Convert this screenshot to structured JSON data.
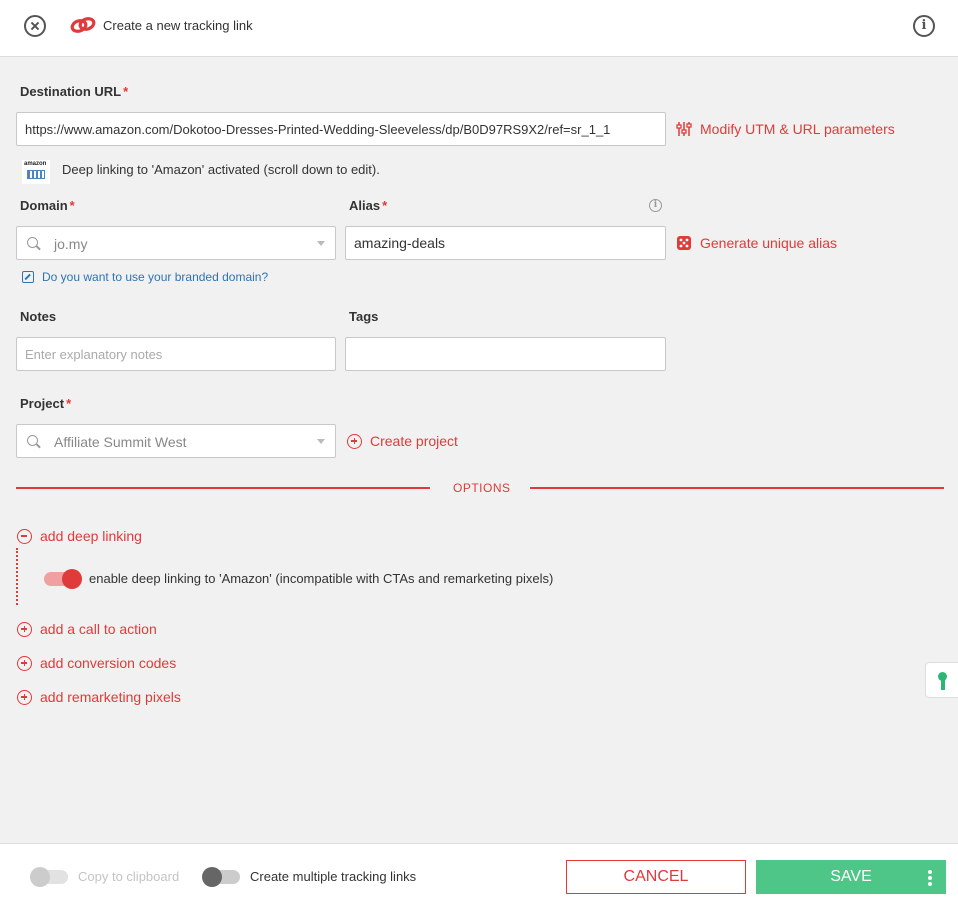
{
  "header": {
    "title": "Create a new tracking link"
  },
  "destination": {
    "label": "Destination URL",
    "value": "https://www.amazon.com/Dokotoo-Dresses-Printed-Wedding-Sleeveless/dp/B0D97RS9X2/ref=sr_1_1",
    "utm_link": "Modify UTM & URL parameters",
    "amazon_logo_text": "amazon",
    "deep_link_note": "Deep linking to 'Amazon' activated (scroll down to edit)."
  },
  "domain": {
    "label": "Domain",
    "value": "jo.my",
    "branded_link": "Do you want to use your branded domain?"
  },
  "alias": {
    "label": "Alias",
    "value": "amazing-deals",
    "generate_link": "Generate unique alias"
  },
  "notes": {
    "label": "Notes",
    "placeholder": "Enter explanatory notes"
  },
  "tags": {
    "label": "Tags",
    "value": ""
  },
  "project": {
    "label": "Project",
    "value": "Affiliate Summit West",
    "create_link": "Create project"
  },
  "required_mark": "*",
  "options": {
    "heading": "OPTIONS",
    "deep_linking": "add deep linking",
    "deep_toggle_label": "enable deep linking to 'Amazon' (incompatible with CTAs and remarketing pixels)",
    "deep_toggle_on": true,
    "call_to_action": "add a call to action",
    "conversion_codes": "add conversion codes",
    "remarketing_pixels": "add remarketing pixels"
  },
  "footer": {
    "copy_label": "Copy to clipboard",
    "copy_on": false,
    "multiple_label": "Create multiple tracking links",
    "multiple_on": false,
    "cancel": "CANCEL",
    "save": "SAVE"
  },
  "colors": {
    "accent": "#e03a3a",
    "save": "#4dc688",
    "link": "#2d74b5"
  }
}
